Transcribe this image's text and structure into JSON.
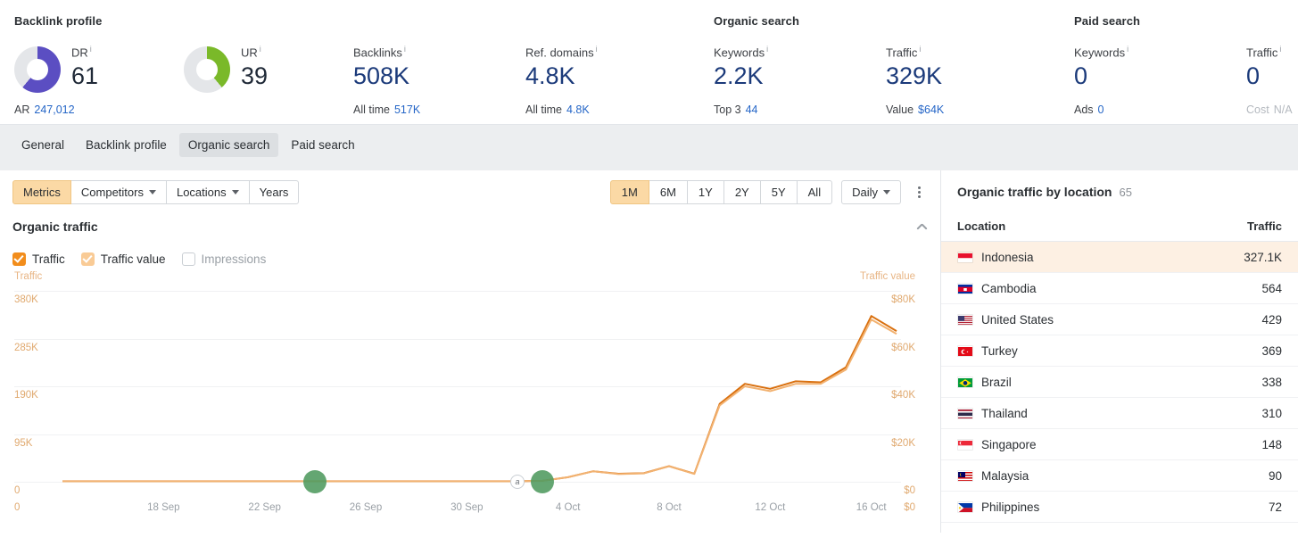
{
  "header": {
    "groups": [
      {
        "title": "Backlink profile",
        "metrics": [
          {
            "kind": "donut",
            "label": "DR",
            "info": "i",
            "value": "61",
            "sub_label": "AR",
            "sub_value": "247,012",
            "donut_color": "#5b4ec2",
            "donut_pct": 61
          },
          {
            "kind": "donut",
            "label": "UR",
            "info": "i",
            "value": "39",
            "sub_label": "",
            "sub_value": "",
            "donut_color": "#7ab929",
            "donut_pct": 39
          },
          {
            "kind": "plain",
            "label": "Backlinks",
            "info": "i",
            "value": "508K",
            "sub_label": "All time",
            "sub_value": "517K"
          },
          {
            "kind": "plain",
            "label": "Ref. domains",
            "info": "i",
            "value": "4.8K",
            "sub_label": "All time",
            "sub_value": "4.8K"
          }
        ]
      },
      {
        "title": "Organic search",
        "metrics": [
          {
            "kind": "plain",
            "label": "Keywords",
            "info": "i",
            "value": "2.2K",
            "sub_label": "Top 3",
            "sub_value": "44"
          },
          {
            "kind": "plain",
            "label": "Traffic",
            "info": "i",
            "value": "329K",
            "sub_label": "Value",
            "sub_value": "$64K"
          }
        ]
      },
      {
        "title": "Paid search",
        "metrics": [
          {
            "kind": "plain",
            "label": "Keywords",
            "info": "i",
            "value": "0",
            "sub_label": "Ads",
            "sub_value": "0"
          },
          {
            "kind": "plain",
            "label": "Traffic",
            "info": "i",
            "value": "0",
            "sub_label": "Cost",
            "sub_value": "N/A",
            "muted": true
          }
        ]
      }
    ]
  },
  "tabs": [
    {
      "label": "General",
      "active": false
    },
    {
      "label": "Backlink profile",
      "active": false
    },
    {
      "label": "Organic search",
      "active": true
    },
    {
      "label": "Paid search",
      "active": false
    }
  ],
  "toolbar": {
    "left_buttons": [
      {
        "label": "Metrics",
        "caret": false,
        "active": true
      },
      {
        "label": "Competitors",
        "caret": true,
        "active": false
      },
      {
        "label": "Locations",
        "caret": true,
        "active": false
      },
      {
        "label": "Years",
        "caret": false,
        "active": false
      }
    ],
    "ranges": [
      {
        "label": "1M",
        "active": true
      },
      {
        "label": "6M",
        "active": false
      },
      {
        "label": "1Y",
        "active": false
      },
      {
        "label": "2Y",
        "active": false
      },
      {
        "label": "5Y",
        "active": false
      },
      {
        "label": "All",
        "active": false
      }
    ],
    "granularity": "Daily",
    "more_menu": "more-options"
  },
  "chart_panel": {
    "title": "Organic traffic",
    "collapse_icon": "chevron-up-icon",
    "legend": [
      {
        "label": "Traffic",
        "state": "checked",
        "color": "#f28d1c"
      },
      {
        "label": "Traffic value",
        "state": "checked-light",
        "color": "#f9cb96"
      },
      {
        "label": "Impressions",
        "state": "unchecked",
        "color": "#ffffff"
      }
    ]
  },
  "chart_data": {
    "type": "line",
    "title": "Organic traffic",
    "xlabel": "",
    "ylabel": "Traffic",
    "y2label": "Traffic value",
    "grid": true,
    "legend_position": "top-left",
    "y_ticks": [
      "0",
      "95K",
      "190K",
      "285K",
      "380K"
    ],
    "ylim": [
      0,
      380000
    ],
    "y2_ticks": [
      "$0",
      "$20K",
      "$40K",
      "$60K",
      "$80K"
    ],
    "y2lim": [
      0,
      80000
    ],
    "x_ticks": [
      "18 Sep",
      "22 Sep",
      "26 Sep",
      "30 Sep",
      "4 Oct",
      "8 Oct",
      "12 Oct",
      "16 Oct"
    ],
    "x": [
      "14 Sep",
      "15 Sep",
      "16 Sep",
      "17 Sep",
      "18 Sep",
      "19 Sep",
      "20 Sep",
      "21 Sep",
      "22 Sep",
      "23 Sep",
      "24 Sep",
      "25 Sep",
      "26 Sep",
      "27 Sep",
      "28 Sep",
      "29 Sep",
      "30 Sep",
      "1 Oct",
      "2 Oct",
      "3 Oct",
      "4 Oct",
      "5 Oct",
      "6 Oct",
      "7 Oct",
      "8 Oct",
      "9 Oct",
      "10 Oct",
      "11 Oct",
      "12 Oct",
      "13 Oct",
      "14 Oct",
      "15 Oct",
      "16 Oct",
      "17 Oct"
    ],
    "series": [
      {
        "name": "Traffic",
        "axis": "left",
        "color": "#d9700f",
        "values": [
          1000,
          1000,
          1000,
          1000,
          1000,
          1000,
          1000,
          1000,
          1000,
          1000,
          1000,
          1000,
          1000,
          1000,
          1000,
          1000,
          1000,
          1000,
          1000,
          2000,
          9000,
          21000,
          16000,
          17000,
          31000,
          16000,
          155000,
          195000,
          185000,
          200000,
          198000,
          228000,
          330000,
          300000
        ]
      },
      {
        "name": "Traffic value",
        "axis": "right",
        "color": "#f2b271",
        "values": [
          200,
          200,
          200,
          200,
          200,
          200,
          200,
          200,
          200,
          200,
          200,
          200,
          200,
          200,
          200,
          200,
          200,
          200,
          200,
          400,
          1900,
          4400,
          3200,
          3500,
          6500,
          3300,
          32000,
          40000,
          38000,
          41000,
          41000,
          47000,
          68000,
          62000
        ]
      }
    ],
    "event_markers": [
      {
        "x_label": "24 Sep",
        "type": "event-dot",
        "color": "#4e9a5e"
      },
      {
        "x_label": "3 Oct",
        "type": "event-dot",
        "color": "#4e9a5e"
      }
    ],
    "annotations": [
      {
        "x_label": "2 Oct",
        "label": "a",
        "type": "annotation-badge"
      }
    ]
  },
  "locations_panel": {
    "title": "Organic traffic by location",
    "count": "65",
    "columns": {
      "location": "Location",
      "traffic": "Traffic"
    },
    "rows": [
      {
        "name": "Indonesia",
        "traffic": "327.1K",
        "highlight": true,
        "flag": "flag-id"
      },
      {
        "name": "Cambodia",
        "traffic": "564",
        "highlight": false,
        "flag": "flag-kh"
      },
      {
        "name": "United States",
        "traffic": "429",
        "highlight": false,
        "flag": "flag-us"
      },
      {
        "name": "Turkey",
        "traffic": "369",
        "highlight": false,
        "flag": "flag-tr"
      },
      {
        "name": "Brazil",
        "traffic": "338",
        "highlight": false,
        "flag": "flag-br"
      },
      {
        "name": "Thailand",
        "traffic": "310",
        "highlight": false,
        "flag": "flag-th"
      },
      {
        "name": "Singapore",
        "traffic": "148",
        "highlight": false,
        "flag": "flag-sg"
      },
      {
        "name": "Malaysia",
        "traffic": "90",
        "highlight": false,
        "flag": "flag-my"
      },
      {
        "name": "Philippines",
        "traffic": "72",
        "highlight": false,
        "flag": "flag-ph"
      }
    ]
  }
}
